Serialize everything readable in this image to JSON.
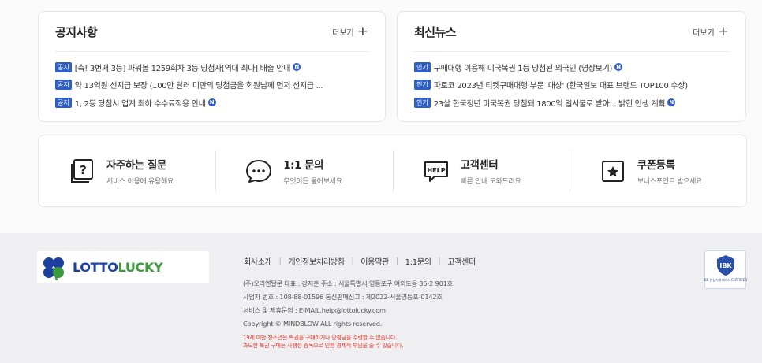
{
  "notice": {
    "title": "공지사항",
    "more": "더보기",
    "items": [
      {
        "tag": "공지",
        "text": "[축! 3번째 3등] 파워볼 1259회차 3등 당첨자[역대 최다] 배출 안내",
        "badge": "N"
      },
      {
        "tag": "공지",
        "text": "약 13억원 선지급 보장 (100만 달러 미만의 당첨금을 회원님께 먼저 선지급 ...",
        "badge": ""
      },
      {
        "tag": "공지",
        "text": "1, 2등 당첨시 업계 최하 수수료적용 안내",
        "badge": "N"
      }
    ]
  },
  "news": {
    "title": "최신뉴스",
    "more": "더보기",
    "items": [
      {
        "tag": "인기",
        "text": "구매대행 이용해 미국복권 1등 당첨된 외국인 (영상보기)",
        "badge": "N"
      },
      {
        "tag": "인기",
        "text": "파로코 2023년 티켓구매대행 부문 '대상' (한국일보 대표 브랜드 TOP100 수상)",
        "badge": ""
      },
      {
        "tag": "인기",
        "text": "23살 한국청년 미국복권 당첨돼 1800억 일시불로 받아... 밝힌 인생 계획",
        "badge": "N"
      }
    ]
  },
  "quick_links": [
    {
      "title": "자주하는 질문",
      "sub": "서비스 이용에 유용해요",
      "icon": "faq-icon"
    },
    {
      "title": "1:1 문의",
      "sub": "무엇이든 물어보세요",
      "icon": "chat-icon"
    },
    {
      "title": "고객센터",
      "sub": "빠른 안내 도와드려요",
      "icon": "help-icon"
    },
    {
      "title": "쿠폰등록",
      "sub": "보너스포인트 받으세요",
      "icon": "coupon-icon"
    }
  ],
  "footer": {
    "logo": {
      "part1": "LOTTO",
      "part2": "LUCKY"
    },
    "links": [
      "회사소개",
      "개인정보처리방침",
      "이용약관",
      "1:1문의",
      "고객센터"
    ],
    "info": [
      "(주)오리엔탈문 대표 : 강지훈 주소 : 서울특별시 영등포구 여의도동 35-2 901호",
      "사업자 번호 : 108-88-01596 통신판매신고 : 제2022-서울영등포-0142호",
      "서비스 및 제휴문의 : E-MAIL.help@lottolucky.com",
      "Copyright © MINDBLOW ALL rights reserved."
    ],
    "warnings": [
      "19세 미만 청소년은 복권을 구매하거나 당첨금을 수령할 수 없습니다.",
      "과도한 복권 구매는 사행성 중독으로 인한 경제적 부담을 줄 수 있습니다."
    ],
    "badge_caption": "IBK 안심거래서비스 CERTIFIED",
    "colors": {
      "brand_blue": "#1c3fa0",
      "brand_green": "#3b9b3b",
      "tag_blue": "#2f5fc4",
      "warning_red": "#e53a2b"
    }
  }
}
